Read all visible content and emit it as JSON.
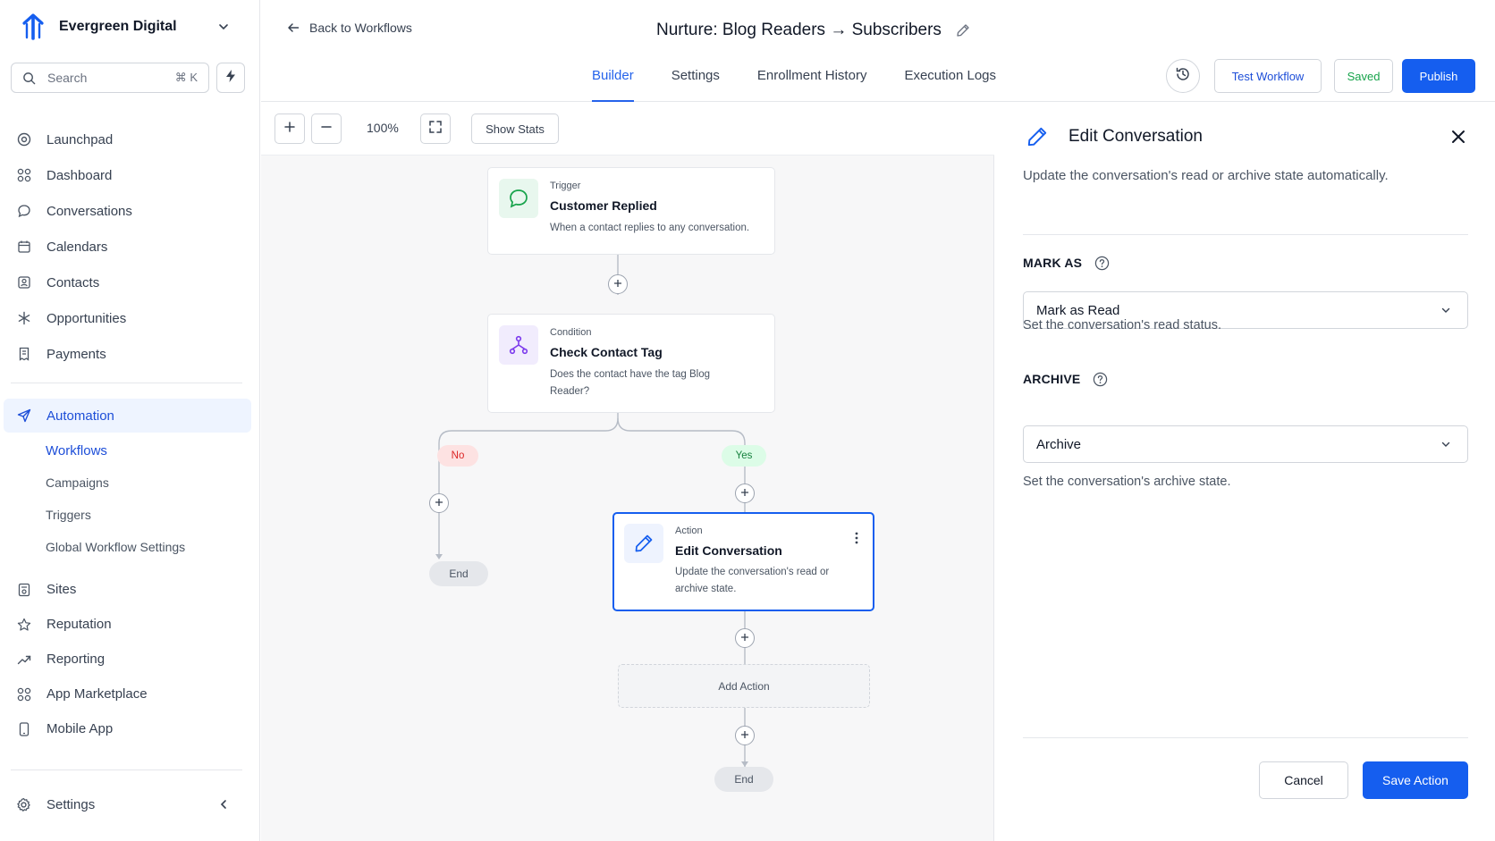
{
  "brand": {
    "name": "Evergreen Digital"
  },
  "search": {
    "placeholder": "Search",
    "shortcut": "⌘ K"
  },
  "nav": {
    "top_items": [
      {
        "label": "Launchpad",
        "icon": "target-icon"
      },
      {
        "label": "Dashboard",
        "icon": "grid-icon"
      },
      {
        "label": "Conversations",
        "icon": "chat-icon"
      },
      {
        "label": "Calendars",
        "icon": "calendar-icon"
      },
      {
        "label": "Contacts",
        "icon": "contact-card-icon"
      },
      {
        "label": "Opportunities",
        "icon": "snowflake-icon"
      },
      {
        "label": "Payments",
        "icon": "receipt-icon"
      }
    ],
    "automation": {
      "label": "Automation",
      "icon": "send-icon"
    },
    "sub_items": [
      {
        "label": "Workflows",
        "active": true
      },
      {
        "label": "Campaigns",
        "active": false
      },
      {
        "label": "Triggers",
        "active": false
      },
      {
        "label": "Global Workflow Settings",
        "active": false
      }
    ],
    "bottom_items": [
      {
        "label": "Sites",
        "icon": "sites-icon"
      },
      {
        "label": "Reputation",
        "icon": "star-icon"
      },
      {
        "label": "Reporting",
        "icon": "trend-icon"
      },
      {
        "label": "App Marketplace",
        "icon": "apps-icon"
      },
      {
        "label": "Mobile App",
        "icon": "phone-icon"
      }
    ],
    "settings": "Settings"
  },
  "header": {
    "back_label": "Back to Workflows",
    "title": "Nurture: Blog Readers → Subscribers",
    "tabs": [
      {
        "label": "Builder",
        "active": true
      },
      {
        "label": "Settings",
        "active": false
      },
      {
        "label": "Enrollment History",
        "active": false
      },
      {
        "label": "Execution Logs",
        "active": false
      }
    ],
    "test_label": "Test Workflow",
    "saved_label": "Saved",
    "publish_label": "Publish"
  },
  "toolbar": {
    "zoom": "100%",
    "stats_label": "Show Stats"
  },
  "flow": {
    "trigger": {
      "kind": "Trigger",
      "title": "Customer Replied",
      "desc": "When a contact replies to any conversation."
    },
    "condition": {
      "kind": "Condition",
      "title": "Check Contact Tag",
      "desc": "Does the contact have the tag Blog Reader?"
    },
    "branch_no": "No",
    "branch_yes": "Yes",
    "action": {
      "kind": "Action",
      "title": "Edit Conversation",
      "desc": "Update the conversation's read or archive state."
    },
    "add_action": "Add Action",
    "end_label": "End"
  },
  "panel": {
    "title": "Edit Conversation",
    "desc": "Update the conversation's read or archive state automatically.",
    "mark_as_label": "MARK AS",
    "mark_as_value": "Mark as Read",
    "mark_as_hint": "Set the conversation's read status.",
    "archive_label": "ARCHIVE",
    "archive_value": "Archive",
    "archive_hint": "Set the conversation's archive state.",
    "cancel_label": "Cancel",
    "save_label": "Save Action"
  },
  "colors": {
    "accent": "#155eef",
    "active_bg": "#eef4ff",
    "saved": "#16a34a",
    "no_bg": "#fde2e2",
    "yes_bg": "#dcfce7"
  }
}
